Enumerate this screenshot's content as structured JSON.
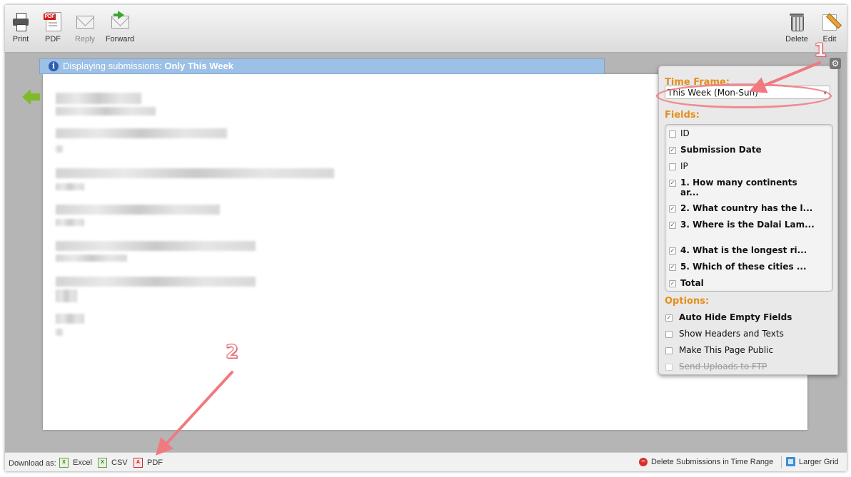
{
  "toolbar": {
    "print": "Print",
    "pdf": "PDF",
    "reply": "Reply",
    "forward": "Forward",
    "delete": "Delete",
    "edit": "Edit"
  },
  "notice": {
    "prefix": "Displaying submissions:",
    "value": "Only This Week"
  },
  "settings": {
    "time_frame_title": "Time Frame:",
    "time_frame_value": "This Week (Mon-Sun)",
    "fields_title": "Fields:",
    "fields": [
      {
        "label": "ID",
        "checked": false,
        "bold": false
      },
      {
        "label": "Submission Date",
        "checked": true,
        "bold": true
      },
      {
        "label": "IP",
        "checked": false,
        "bold": false
      },
      {
        "label": "1. How many continents ar...",
        "checked": true,
        "bold": true
      },
      {
        "label": "2. What country has the l...",
        "checked": true,
        "bold": true
      },
      {
        "label": "3. Where is the Dalai Lam...",
        "checked": true,
        "bold": true
      },
      {
        "label": "4. What is the longest ri...",
        "checked": true,
        "bold": true
      },
      {
        "label": "5. Which of these cities ...",
        "checked": true,
        "bold": true
      },
      {
        "label": "Total",
        "checked": true,
        "bold": true
      }
    ],
    "options_title": "Options:",
    "options": [
      {
        "label": "Auto Hide Empty Fields",
        "checked": true,
        "bold": true,
        "disabled": false
      },
      {
        "label": "Show Headers and Texts",
        "checked": false,
        "bold": false,
        "disabled": false
      },
      {
        "label": "Make This Page Public",
        "checked": false,
        "bold": false,
        "disabled": false
      },
      {
        "label": "Send Uploads to FTP",
        "checked": false,
        "bold": false,
        "disabled": true
      }
    ]
  },
  "annotations": {
    "marker_1": "1",
    "marker_2": "2",
    "color": "#f07a80"
  },
  "bottom": {
    "download_label": "Download as:",
    "excel": "Excel",
    "csv": "CSV",
    "pdf": "PDF",
    "delete_range": "Delete Submissions in Time Range",
    "larger_grid": "Larger Grid"
  }
}
